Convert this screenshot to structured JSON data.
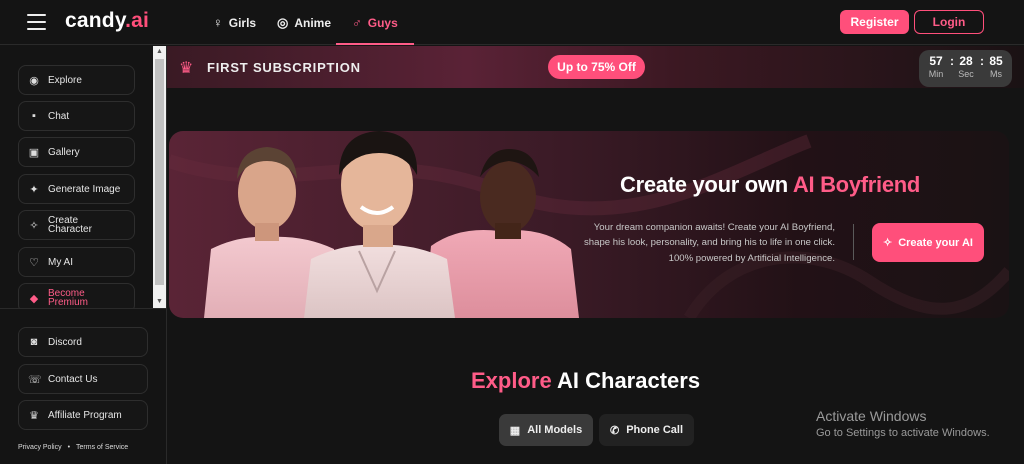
{
  "brand": {
    "name": "candy",
    "suffix": ".ai",
    "accent": "#ff4f7b"
  },
  "nav": {
    "tabs": [
      {
        "label": "Girls",
        "icon": "female-icon"
      },
      {
        "label": "Anime",
        "icon": "anime-icon"
      },
      {
        "label": "Guys",
        "icon": "male-icon",
        "active": true
      }
    ],
    "register": "Register",
    "login": "Login"
  },
  "sidebar": {
    "items": [
      {
        "label": "Explore",
        "icon": "compass-icon"
      },
      {
        "label": "Chat",
        "icon": "chat-icon"
      },
      {
        "label": "Gallery",
        "icon": "gallery-icon"
      },
      {
        "label": "Generate Image",
        "icon": "generate-image-icon"
      },
      {
        "label": "Create Character",
        "icon": "wand-icon"
      },
      {
        "label": "My AI",
        "icon": "heart-icon"
      },
      {
        "label": "Become Premium",
        "icon": "diamond-icon"
      }
    ],
    "bottom_items": [
      {
        "label": "Discord",
        "icon": "discord-icon"
      },
      {
        "label": "Contact Us",
        "icon": "contact-icon"
      },
      {
        "label": "Affiliate Program",
        "icon": "trophy-icon"
      }
    ],
    "footer": {
      "privacy": "Privacy Policy",
      "separator": "•",
      "terms": "Terms of Service"
    }
  },
  "promo": {
    "title": "FIRST SUBSCRIPTION",
    "discount": "Up to 75% Off",
    "timer": {
      "min": "57",
      "sec": "28",
      "ms": "85",
      "min_label": "Min",
      "sec_label": "Sec",
      "ms_label": "Ms",
      "sep": ":"
    }
  },
  "hero": {
    "title_part1": "Create your own ",
    "title_part2": "AI Boyfriend",
    "description": "Your dream companion awaits! Create your AI Boyfriend, shape his look, personality, and bring his to life in one click. 100% powered by Artificial Intelligence.",
    "cta": "Create your AI"
  },
  "explore": {
    "title_part1": "Explore",
    "title_part2": " AI Characters",
    "filters": [
      {
        "label": "All Models",
        "icon": "grid-icon",
        "active": true
      },
      {
        "label": "Phone Call",
        "icon": "phone-icon"
      }
    ]
  },
  "watermark": {
    "line1": "Activate Windows",
    "line2": "Go to Settings to activate Windows."
  }
}
